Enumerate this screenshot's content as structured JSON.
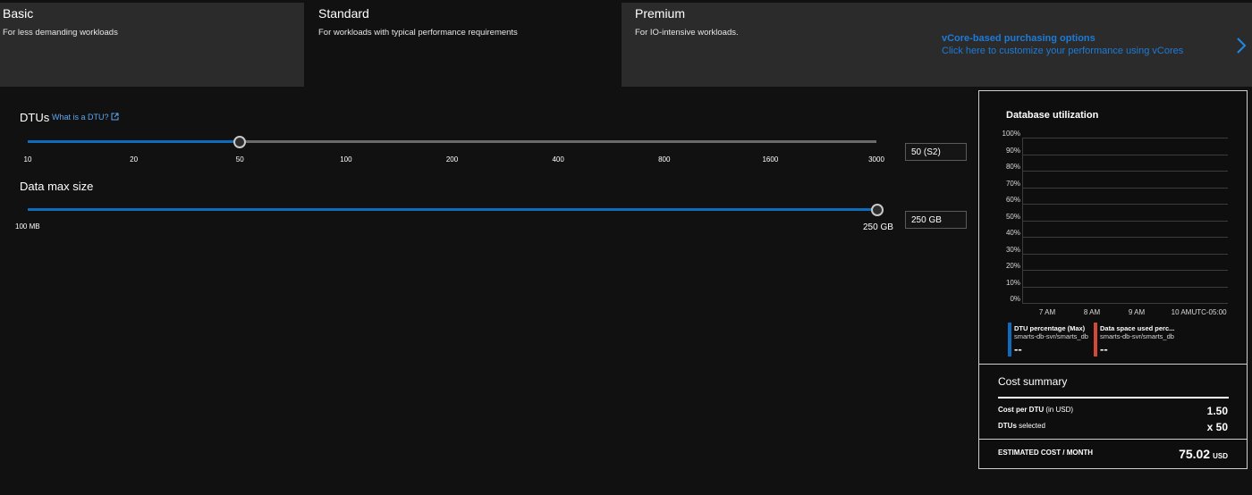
{
  "tiers": [
    {
      "name": "Basic",
      "description": "For less demanding workloads"
    },
    {
      "name": "Standard",
      "description": "For workloads with typical performance requirements"
    },
    {
      "name": "Premium",
      "description": "For IO-intensive workloads."
    }
  ],
  "selected_tier": "Standard",
  "vcore": {
    "title": "vCore-based purchasing options",
    "subtitle": "Click here to customize your performance using vCores"
  },
  "dtu": {
    "label": "DTUs",
    "help_link": "What is a DTU?",
    "ticks": [
      "10",
      "20",
      "50",
      "100",
      "200",
      "400",
      "800",
      "1600",
      "3000"
    ],
    "selected_index": 2,
    "value": "50 (S2)"
  },
  "data_size": {
    "label": "Data max size",
    "min_label": "100 MB",
    "max_label": "250 GB",
    "fraction": 1.0,
    "value": "250 GB"
  },
  "utilization": {
    "title": "Database utilization",
    "y_ticks": [
      "100%",
      "90%",
      "80%",
      "70%",
      "60%",
      "50%",
      "40%",
      "30%",
      "20%",
      "10%",
      "0%"
    ],
    "x_ticks": [
      "7 AM",
      "8 AM",
      "9 AM",
      "10 AM"
    ],
    "timezone": "UTC-05:00",
    "legend": [
      {
        "name": "DTU percentage (Max)",
        "resource": "smarts-db-svr/smarts_db",
        "value": "--",
        "color": "#0f6cbd"
      },
      {
        "name": "Data space used perc...",
        "resource": "smarts-db-svr/smarts_db",
        "value": "--",
        "color": "#d04a35"
      }
    ]
  },
  "cost": {
    "title": "Cost summary",
    "cost_per_dtu_label_bold": "Cost per DTU",
    "cost_per_dtu_label_rest": " (in USD)",
    "cost_per_dtu_value": "1.50",
    "dtus_selected_label_bold": "DTUs",
    "dtus_selected_label_rest": " selected",
    "dtus_selected_value": "x 50",
    "estimated_label": "ESTIMATED COST / MONTH",
    "estimated_value": "75.02",
    "estimated_unit": "USD"
  }
}
